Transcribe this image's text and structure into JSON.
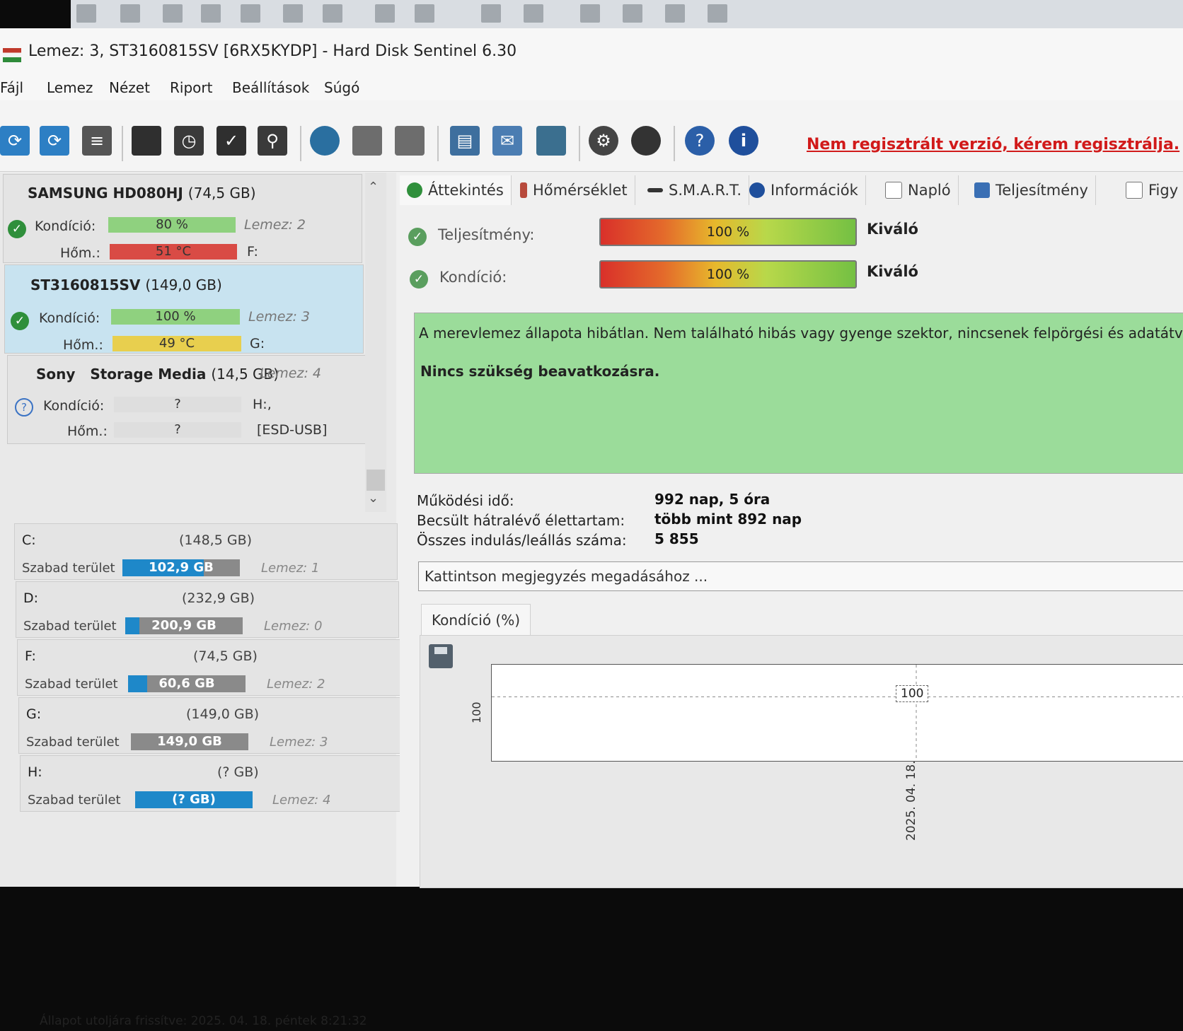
{
  "window": {
    "title": "Lemez: 3, ST3160815SV [6RX5KYDP]  -  Hard Disk Sentinel 6.30"
  },
  "menu": [
    {
      "label": "Fájl"
    },
    {
      "label": "Lemez"
    },
    {
      "label": "Nézet"
    },
    {
      "label": "Riport"
    },
    {
      "label": "Beállítások"
    },
    {
      "label": "Súgó"
    }
  ],
  "toolbar": {
    "register_link": "Nem regisztrált verzió, kérem regisztrálja.",
    "icons": [
      "refresh-icon",
      "refresh-all-icon",
      "disk-list-icon",
      "disk-icon",
      "disk-clock-icon",
      "disk-check-icon",
      "disk-search-icon",
      "globe-icon",
      "network-drive-icon",
      "usb-drive-icon",
      "notepad-icon",
      "mail-icon",
      "network-icon",
      "gear-icon",
      "speaker-icon",
      "help-icon",
      "info-icon"
    ]
  },
  "disks": [
    {
      "name": "SAMSUNG HD080HJ",
      "size": "(74,5 GB)",
      "condition_label": "Kondíció:",
      "condition": "80 %",
      "condition_level": 0.8,
      "temp_label": "Hőm.:",
      "temp": "51 °C",
      "disk_no": "Lemez: 2",
      "drive": "F:",
      "color": "#d94b45"
    },
    {
      "name": "ST3160815SV",
      "size": "(149,0 GB)",
      "condition_label": "Kondíció:",
      "condition": "100 %",
      "condition_level": 1.0,
      "temp_label": "Hőm.:",
      "temp": "49 °C",
      "disk_no": "Lemez: 3",
      "drive": "G:",
      "color": "#e8cf4e"
    },
    {
      "name": "Sony",
      "name2": "Storage Media",
      "size": "(14,5 GB)",
      "disk_no": "Lemez: 4",
      "condition_label": "Kondíció:",
      "condition": "?",
      "temp_label": "Hőm.:",
      "temp": "?",
      "drive": "H:,",
      "extra": "[ESD-USB]"
    }
  ],
  "volumes": [
    {
      "letter": "C:",
      "size": "(148,5 GB)",
      "free_label": "Szabad terület",
      "free": "102,9 GB",
      "free_ratio": 0.69,
      "disk": "Lemez: 1"
    },
    {
      "letter": "D:",
      "size": "(232,9 GB)",
      "free_label": "Szabad terület",
      "free": "200,9 GB",
      "free_ratio": 0.12,
      "disk": "Lemez: 0"
    },
    {
      "letter": "F:",
      "size": "(74,5 GB)",
      "free_label": "Szabad terület",
      "free": "60,6 GB",
      "free_ratio": 0.16,
      "disk": "Lemez: 2"
    },
    {
      "letter": "G:",
      "size": "(149,0 GB)",
      "free_label": "Szabad terület",
      "free": "149,0 GB",
      "free_ratio": 0.0,
      "disk": "Lemez: 3"
    },
    {
      "letter": "H:",
      "size": "(? GB)",
      "free_label": "Szabad terület",
      "free": "(? GB)",
      "free_ratio": 1.0,
      "disk": "Lemez: 4"
    }
  ],
  "statusbar": {
    "text": "Állapot utoljára frissítve: 2025. 04. 18. péntek 8:21:32"
  },
  "tabs": [
    {
      "label": "Áttekintés",
      "active": true
    },
    {
      "label": "Hőmérséklet"
    },
    {
      "label": "S.M.A.R.T."
    },
    {
      "label": "Információk"
    },
    {
      "label": "Napló"
    },
    {
      "label": "Teljesítmény"
    },
    {
      "label": "Figy"
    }
  ],
  "overview": {
    "performance_label": "Teljesítmény:",
    "performance": "100 %",
    "performance_rating": "Kiváló",
    "condition_label": "Kondíció:",
    "condition": "100 %",
    "condition_rating": "Kiváló",
    "status_text": "A merevlemez állapota hibátlan. Nem található hibás vagy gyenge szektor, nincsenek felpörgési és adatátv",
    "action_text": "Nincs szükség beavatkozásra.",
    "uptime_label": "Működési idő:",
    "uptime": "992 nap, 5 óra",
    "remaining_label": "Becsült hátralévő élettartam:",
    "remaining": "több mint 892 nap",
    "starts_label": "Összes indulás/leállás száma:",
    "starts": "5 855",
    "note_placeholder": "Kattintson megjegyzés megadásához ..."
  },
  "chart_tab": {
    "label": "Kondíció  (%)"
  },
  "chart_data": {
    "type": "line",
    "x": [
      "2025. 04. 18."
    ],
    "series": [
      {
        "values": [
          100
        ]
      }
    ],
    "ytick": "100",
    "point_label": "100",
    "grid": false
  }
}
